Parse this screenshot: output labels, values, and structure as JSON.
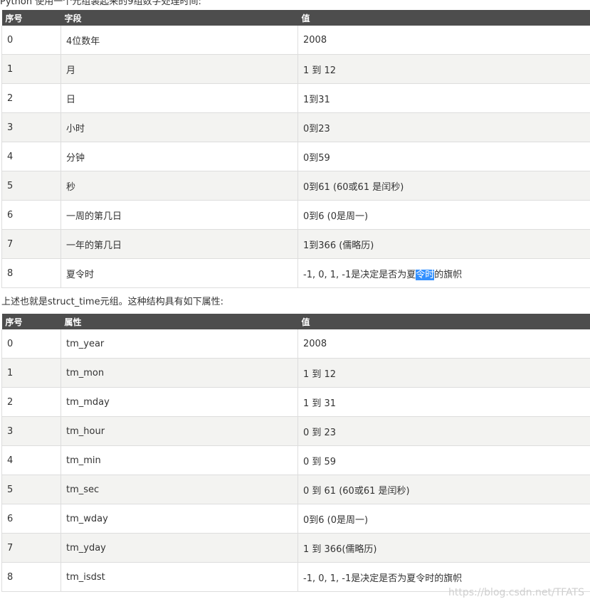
{
  "top_text": "Python 使用一个元组装起来的9组数字处理时间:",
  "table1": {
    "headers": [
      "序号",
      "字段",
      "值"
    ],
    "rows": [
      [
        "0",
        "4位数年",
        "2008"
      ],
      [
        "1",
        "月",
        "1 到 12"
      ],
      [
        "2",
        "日",
        "1到31"
      ],
      [
        "3",
        "小时",
        "0到23"
      ],
      [
        "4",
        "分钟",
        "0到59"
      ],
      [
        "5",
        "秒",
        "0到61 (60或61 是闰秒)"
      ],
      [
        "6",
        "一周的第几日",
        "0到6 (0是周一)"
      ],
      [
        "7",
        "一年的第几日",
        "1到366 (儒略历)"
      ]
    ],
    "last_row": {
      "index": "8",
      "field": "夏令时",
      "value_before": "-1, 0, 1, -1是决定是否为夏",
      "value_selected": "令时",
      "value_after": "的旗帜"
    }
  },
  "middle_text": "上述也就是struct_time元组。这种结构具有如下属性:",
  "table2": {
    "headers": [
      "序号",
      "属性",
      "值"
    ],
    "rows": [
      [
        "0",
        "tm_year",
        "2008"
      ],
      [
        "1",
        "tm_mon",
        "1 到 12"
      ],
      [
        "2",
        "tm_mday",
        "1 到 31"
      ],
      [
        "3",
        "tm_hour",
        "0 到 23"
      ],
      [
        "4",
        "tm_min",
        "0 到 59"
      ],
      [
        "5",
        "tm_sec",
        "0 到 61 (60或61 是闰秒)"
      ],
      [
        "6",
        "tm_wday",
        "0到6 (0是周一)"
      ],
      [
        "7",
        "tm_yday",
        "1 到 366(儒略历)"
      ],
      [
        "8",
        "tm_isdst",
        "-1, 0, 1, -1是决定是否为夏令时的旗帜"
      ]
    ]
  },
  "watermark": "https://blog.csdn.net/TFATS",
  "colors": {
    "header_bg": "#4d4d4d",
    "row_alt_bg": "#f3f3f1",
    "selection": "#3390ff",
    "border": "#dddddd"
  }
}
